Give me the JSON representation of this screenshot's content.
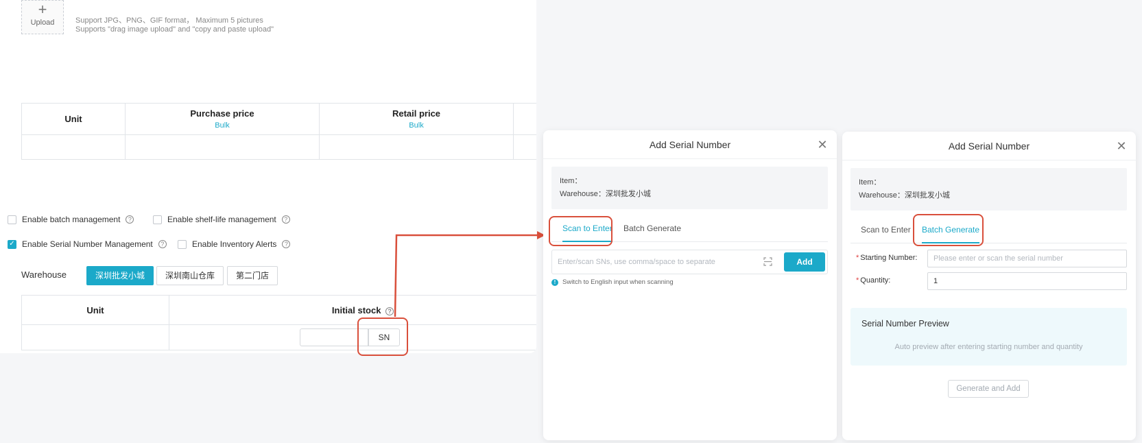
{
  "form": {
    "upload": {
      "icon": "plus-icon",
      "label": "Upload",
      "tip_line1": "Support JPG、PNG、GIF format， Maximum 5 pictures",
      "tip_line2": "Supports \"drag image upload\" and \"copy and paste upload\""
    },
    "price_table": {
      "headers": [
        "Unit",
        "Purchase price",
        "Retail price"
      ],
      "bulk_label": "Bulk"
    },
    "options": [
      {
        "label": "Enable batch management",
        "checked": false
      },
      {
        "label": "Enable shelf-life management",
        "checked": false
      },
      {
        "label": "Enable Serial Number Management",
        "checked": true
      },
      {
        "label": "Enable Inventory Alerts",
        "checked": false
      }
    ],
    "warehouse": {
      "label": "Warehouse",
      "items": [
        "深圳批发小城",
        "深圳南山仓库",
        "第二门店"
      ],
      "active_index": 0
    },
    "stock_table": {
      "headers": [
        "Unit",
        "Initial stock"
      ],
      "sn_button": "SN"
    },
    "accent_color": "#1ba9c9",
    "highlight_color": "#d94f3b"
  },
  "dialog_scan": {
    "title": "Add Serial Number",
    "item_label": "Item：",
    "warehouse_line": "Warehouse：深圳批发小城",
    "tabs": [
      "Scan to Enter",
      "Batch Generate"
    ],
    "active_tab": 0,
    "input_placeholder": "Enter/scan SNs, use comma/space to separate",
    "add_label": "Add",
    "tip": "Switch to English input when scanning"
  },
  "dialog_batch": {
    "title": "Add Serial Number",
    "item_label": "Item：",
    "warehouse_line": "Warehouse：深圳批发小城",
    "tabs": [
      "Scan to Enter",
      "Batch Generate"
    ],
    "active_tab": 1,
    "starting_number_label": "Starting Number:",
    "starting_number_placeholder": "Please enter or scan the serial number",
    "quantity_label": "Quantity:",
    "quantity_value": "1",
    "preview_title": "Serial Number Preview",
    "preview_hint": "Auto preview after entering starting number and quantity",
    "generate_label": "Generate and Add"
  }
}
